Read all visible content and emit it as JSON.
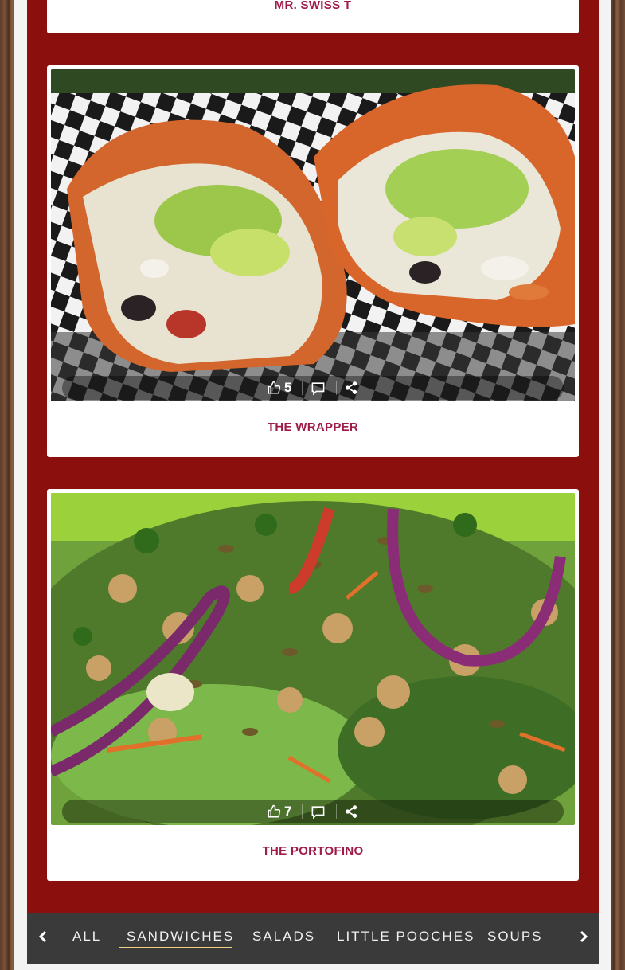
{
  "cards": [
    {
      "title": "MR. SWISS T"
    },
    {
      "title": "THE WRAPPER",
      "likes": "5"
    },
    {
      "title": "THE PORTOFINO",
      "likes": "7"
    }
  ],
  "categories": {
    "tabs": [
      "ALL",
      "SANDWICHES",
      "SALADS",
      "LITTLE POOCHES",
      "SOUPS"
    ],
    "active": "SANDWICHES"
  },
  "colors": {
    "panel": "#8a0f0d",
    "title": "#a01c48",
    "nav": "#3a3a3a",
    "active_underline": "#f2d184"
  },
  "icons": [
    "thumbs-up-icon",
    "comment-icon",
    "share-icon",
    "chevron-left-icon",
    "chevron-right-icon"
  ]
}
